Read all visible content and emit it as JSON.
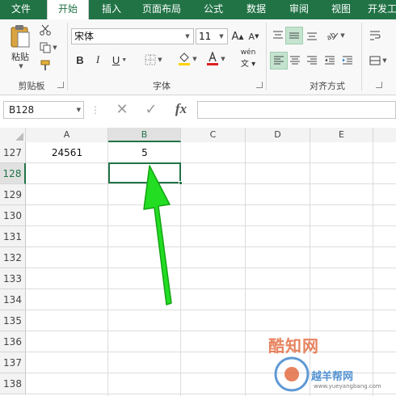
{
  "tabs": [
    "文件",
    "开始",
    "插入",
    "页面布局",
    "公式",
    "数据",
    "审阅",
    "视图",
    "开发工"
  ],
  "active_tab": "开始",
  "clipboard": {
    "paste_label": "粘贴",
    "group_label": "剪贴板"
  },
  "font": {
    "name": "宋体",
    "size": "11",
    "group_label": "字体",
    "bold": "B",
    "italic": "I",
    "underline": "U",
    "grow": "A",
    "shrink": "A",
    "phonetic": "wén"
  },
  "alignment": {
    "group_label": "对齐方式"
  },
  "namebox": {
    "value": "B128"
  },
  "formula": {
    "cancel": "✕",
    "enter": "✓",
    "fx": "fx",
    "value": ""
  },
  "columns": [
    "A",
    "B",
    "C",
    "D",
    "E"
  ],
  "selected_column": "B",
  "rows": [
    {
      "num": "127",
      "a": "24561",
      "b": "5"
    },
    {
      "num": "128",
      "a": "",
      "b": ""
    },
    {
      "num": "129",
      "a": "",
      "b": ""
    },
    {
      "num": "130",
      "a": "",
      "b": ""
    },
    {
      "num": "131",
      "a": "",
      "b": ""
    },
    {
      "num": "132",
      "a": "",
      "b": ""
    },
    {
      "num": "133",
      "a": "",
      "b": ""
    },
    {
      "num": "134",
      "a": "",
      "b": ""
    },
    {
      "num": "135",
      "a": "",
      "b": ""
    },
    {
      "num": "136",
      "a": "",
      "b": ""
    },
    {
      "num": "137",
      "a": "",
      "b": ""
    },
    {
      "num": "138",
      "a": "",
      "b": ""
    }
  ],
  "selected_row": "128",
  "watermark": {
    "title": "酷知网",
    "subtitle": "越羊帮网",
    "url": "www.yueyangbang.com"
  },
  "colors": {
    "brand": "#217346",
    "arrow": "#22dd22"
  }
}
